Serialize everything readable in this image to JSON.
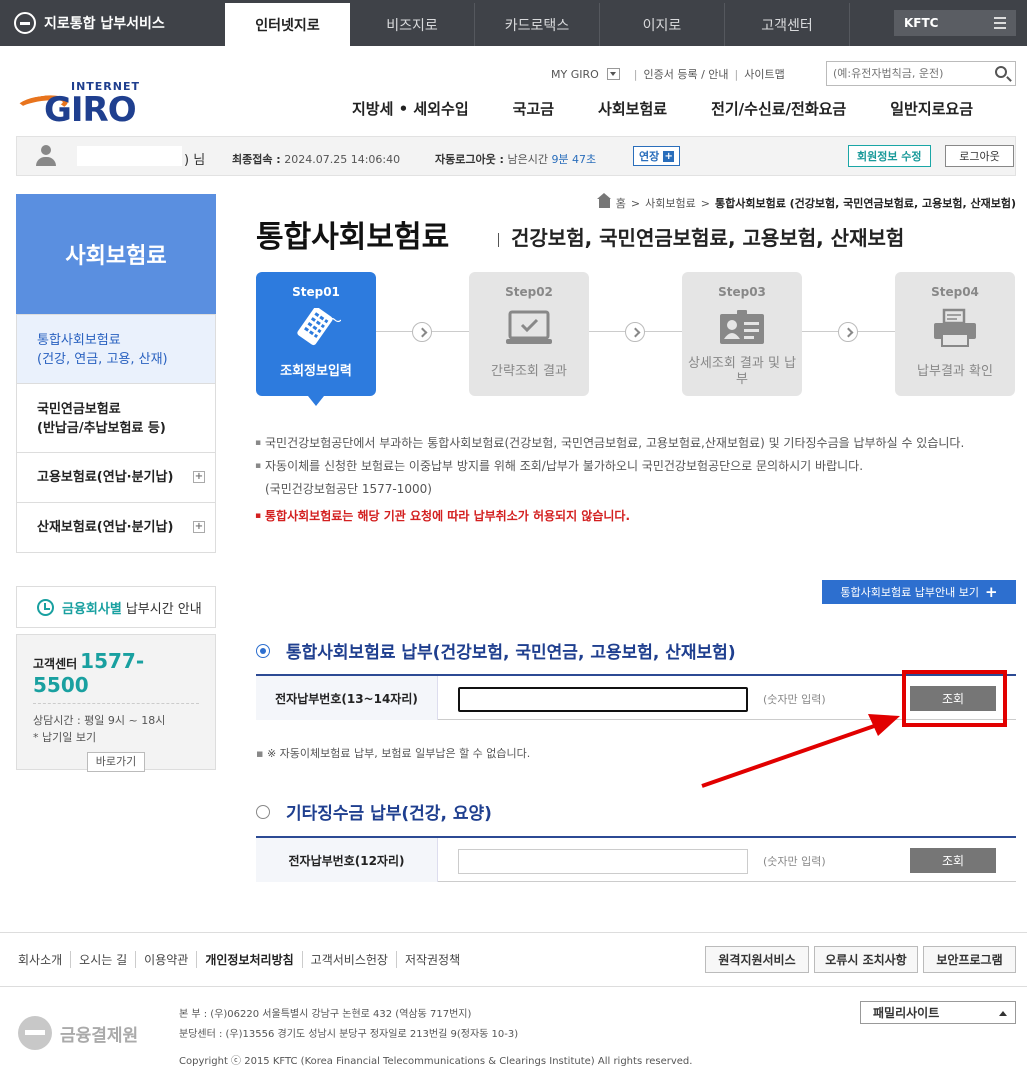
{
  "topbar": {
    "brand": "지로통합 납부서비스",
    "tabs": [
      "인터넷지로",
      "비즈지로",
      "카드로택스",
      "이지로",
      "고객센터"
    ],
    "kftc": "KFTC"
  },
  "header": {
    "logo_internet": "INTERNET",
    "logo_word": "GIRO",
    "util_links": [
      "MY GIRO",
      "인증서 등록 / 안내",
      "사이트맵"
    ],
    "search_placeholder": "(예:유전자법칙금, 운전)",
    "gnb": [
      "지방세 • 세외수입",
      "국고금",
      "사회보험료",
      "전기/수신료/전화요금",
      "일반지로요금"
    ]
  },
  "userbar": {
    "name_suffix": ") 님",
    "last_login_label": "최종접속 :",
    "last_login_value": "2024.07.25 14:06:40",
    "auto_logout_label": "자동로그아웃 :",
    "remain_label": "남은시간",
    "remain_value": "9분 47초",
    "extend": "연장",
    "member_edit": "회원정보 수정",
    "logout": "로그아웃"
  },
  "sidebar": {
    "title": "사회보험료",
    "items": [
      {
        "line1": "통합사회보험료",
        "line2": "(건강, 연금, 고용, 산재)"
      },
      {
        "line1": "국민연금보험료",
        "line2": "(반납금/추납보험료 등)"
      },
      {
        "line1": "고용보험료(연납·분기납)",
        "line2": ""
      },
      {
        "line1": "산재보험료(연납·분기납)",
        "line2": ""
      }
    ],
    "time_hl": "금융회사별",
    "time_rest": "납부시간 안내",
    "cs_label": "고객센터",
    "cs_number": "1577-5500",
    "cs_hours": "상담시간 : 평일 9시 ~ 18시",
    "cs_holiday": "* 납기일 보기",
    "cs_go": "바로가기"
  },
  "breadcrumb": [
    "홈",
    "사회보험료",
    "통합사회보험료 (건강보험, 국민연금보험료, 고용보험, 산재보험)"
  ],
  "page": {
    "title": "통합사회보험료",
    "subtitle": "건강보험, 국민연금보험료, 고용보험, 산재보험"
  },
  "steps": [
    {
      "no": "Step01",
      "label": "조회정보입력",
      "icon": "card-keypad-icon"
    },
    {
      "no": "Step02",
      "label": "간략조회 결과",
      "icon": "monitor-check-icon"
    },
    {
      "no": "Step03",
      "label": "상세조회 결과 및 납부",
      "icon": "id-card-icon"
    },
    {
      "no": "Step04",
      "label": "납부결과 확인",
      "icon": "printer-icon"
    }
  ],
  "notes": {
    "n1": "국민건강보험공단에서 부과하는 통합사회보험료(건강보험, 국민연금보험료, 고용보험료,산재보험료) 및 기타징수금을 납부하실 수 있습니다.",
    "n2": "자동이체를 신청한 보험료는 이중납부 방지를 위해 조회/납부가 불가하오니 국민건강보험공단으로 문의하시기 바랍니다.",
    "n2b": "(국민건강보험공단 1577-1000)",
    "n3": "통합사회보험료는 해당 기관 요청에 따라 납부취소가 허용되지 않습니다."
  },
  "guide_button": "통합사회보험료 납부안내 보기",
  "section1": {
    "title": "통합사회보험료 납부(건강보험, 국민연금, 고용보험, 산재보험)",
    "field_label": "전자납부번호(13~14자리)",
    "hint": "(숫자만 입력)",
    "button": "조회",
    "warn": "※ 자동이체보험료 납부, 보험료 일부납은 할 수 없습니다."
  },
  "section2": {
    "title": "기타징수금 납부(건강, 요양)",
    "field_label": "전자납부번호(12자리)",
    "hint": "(숫자만 입력)",
    "button": "조회"
  },
  "footer": {
    "links": [
      "회사소개",
      "오시는 길",
      "이용약관",
      "개인정보처리방침",
      "고객서비스헌장",
      "저작권정책"
    ],
    "buttons": [
      "원격지원서비스",
      "오류시 조치사항",
      "보안프로그램"
    ],
    "org": "금융결제원",
    "addr1": "본      부 : (우)06220 서울특별시 강남구 논현로 432 (역삼동 717번지)",
    "addr2": "분당센터 : (우)13556 경기도 성남시 분당구 정자일로 213번길 9(정자동 10-3)",
    "copyright": "Copyright ⓒ 2015 KFTC (Korea Financial Telecommunications & Clearings Institute) All rights reserved.",
    "family_site": "패밀리사이트"
  },
  "colors": {
    "accent": "#2d7bde",
    "teal": "#19a0a0",
    "annotation": "#e10000"
  }
}
